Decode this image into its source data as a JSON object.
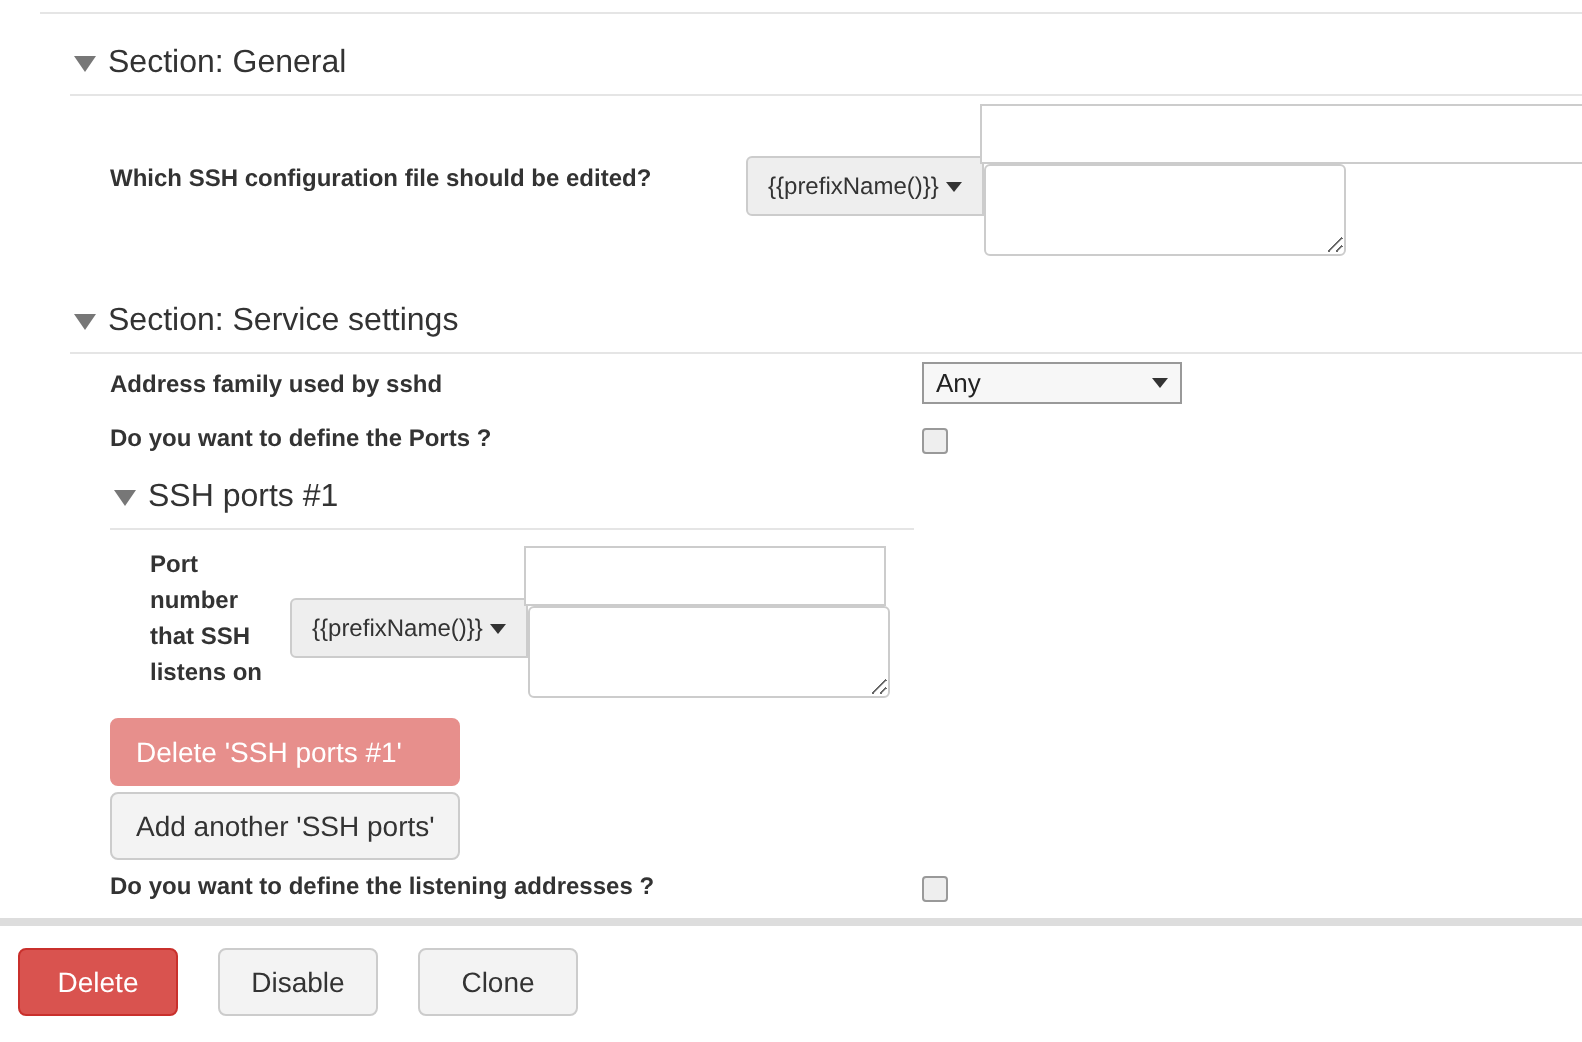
{
  "sections": [
    {
      "title": "Section: General",
      "expanded": true,
      "rows": [
        {
          "kind": "prefixed",
          "label": "Which SSH configuration file should be edited?",
          "prefix": "{{prefixName()}}"
        }
      ]
    },
    {
      "title": "Section: Service settings",
      "expanded": true,
      "rows": [
        {
          "kind": "select",
          "label": "Address family used by sshd",
          "value": "Any"
        },
        {
          "kind": "checkbox",
          "label": "Do you want to define the Ports ?",
          "checked": false
        },
        {
          "kind": "group",
          "title": "SSH ports #1",
          "expanded": true,
          "label": "Port number that SSH listens on",
          "prefix": "{{prefixName()}}",
          "delete_label": "Delete 'SSH ports #1'",
          "add_label": "Add another 'SSH ports'"
        },
        {
          "kind": "checkbox",
          "label": "Do you want to define the listening addresses ?",
          "checked": false
        }
      ]
    }
  ],
  "footer_buttons": [
    {
      "kind": "danger",
      "label": "Delete"
    },
    {
      "kind": "default",
      "label": "Disable"
    },
    {
      "kind": "default",
      "label": "Clone"
    }
  ]
}
